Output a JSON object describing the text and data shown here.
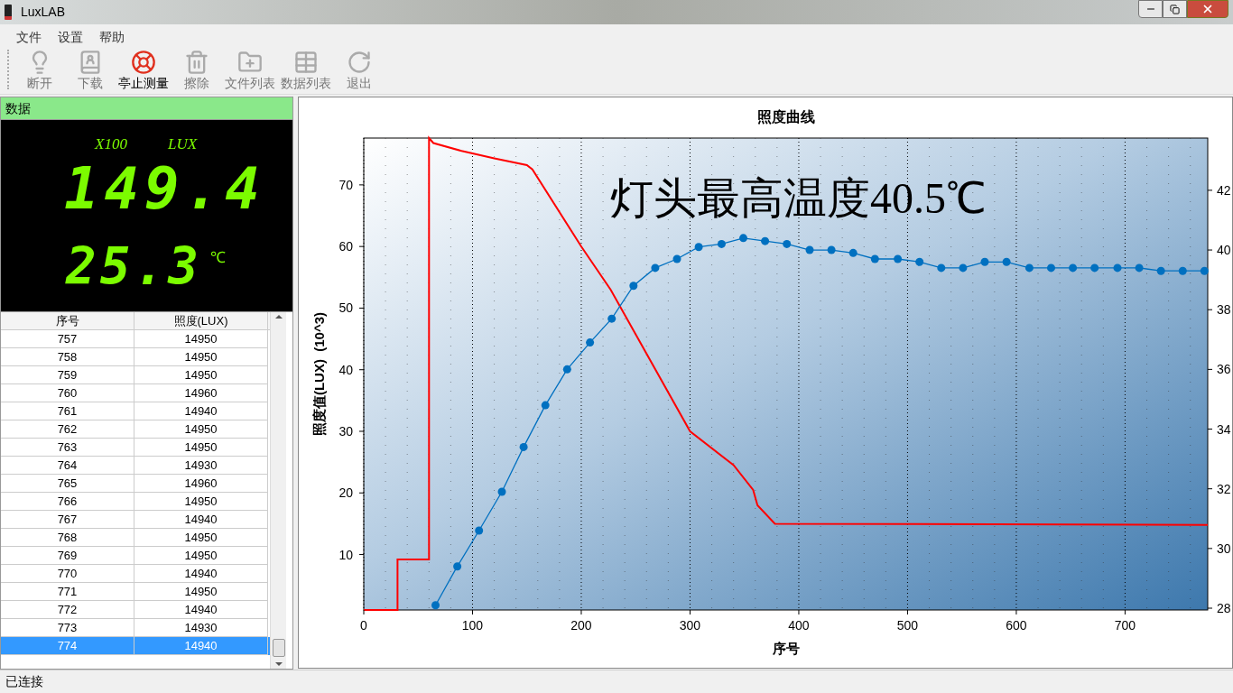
{
  "window": {
    "title": "LuxLAB"
  },
  "menu": [
    "文件",
    "设置",
    "帮助"
  ],
  "toolbar": [
    {
      "label": "断开",
      "disabled": true
    },
    {
      "label": "下载",
      "disabled": true
    },
    {
      "label": "亭止测量",
      "disabled": false
    },
    {
      "label": "擦除",
      "disabled": true
    },
    {
      "label": "文件列表",
      "disabled": true
    },
    {
      "label": "数据列表",
      "disabled": true
    },
    {
      "label": "退出",
      "disabled": true
    }
  ],
  "data_panel": {
    "title": "数据",
    "scale": "X100",
    "unit": "LUX",
    "reading": "149.4",
    "temperature": "25.3",
    "temp_unit": "℃"
  },
  "table": {
    "columns": [
      "序号",
      "照度(LUX)"
    ],
    "rows": [
      {
        "cells": [
          "757",
          "14950"
        ],
        "selected": false
      },
      {
        "cells": [
          "758",
          "14950"
        ],
        "selected": false
      },
      {
        "cells": [
          "759",
          "14950"
        ],
        "selected": false
      },
      {
        "cells": [
          "760",
          "14960"
        ],
        "selected": false
      },
      {
        "cells": [
          "761",
          "14940"
        ],
        "selected": false
      },
      {
        "cells": [
          "762",
          "14950"
        ],
        "selected": false
      },
      {
        "cells": [
          "763",
          "14950"
        ],
        "selected": false
      },
      {
        "cells": [
          "764",
          "14930"
        ],
        "selected": false
      },
      {
        "cells": [
          "765",
          "14960"
        ],
        "selected": false
      },
      {
        "cells": [
          "766",
          "14950"
        ],
        "selected": false
      },
      {
        "cells": [
          "767",
          "14940"
        ],
        "selected": false
      },
      {
        "cells": [
          "768",
          "14950"
        ],
        "selected": false
      },
      {
        "cells": [
          "769",
          "14950"
        ],
        "selected": false
      },
      {
        "cells": [
          "770",
          "14940"
        ],
        "selected": false
      },
      {
        "cells": [
          "771",
          "14950"
        ],
        "selected": false
      },
      {
        "cells": [
          "772",
          "14940"
        ],
        "selected": false
      },
      {
        "cells": [
          "773",
          "14930"
        ],
        "selected": false
      },
      {
        "cells": [
          "774",
          "14940"
        ],
        "selected": true
      }
    ]
  },
  "chart": {
    "chart_data": {
      "type": "line",
      "title": "照度曲线",
      "xlabel": "序号",
      "ylabel": "照度值(LUX)  (10^3)",
      "xlim": [
        0,
        776
      ],
      "ylim": [
        1,
        77.6
      ],
      "y2lim": [
        27.94,
        43.75
      ],
      "xticks": [
        0,
        100,
        200,
        300,
        400,
        500,
        600,
        700
      ],
      "yticks": [
        10,
        20,
        30,
        40,
        50,
        60,
        70
      ],
      "y2ticks": [
        28,
        30,
        32,
        34,
        36,
        38,
        40,
        42
      ],
      "annotations": [
        "灯头最高温度40.5℃"
      ],
      "grid": "x",
      "series": [
        {
          "color": "#ff0000",
          "x": [
            0,
            31,
            31,
            60,
            60,
            64,
            90,
            120,
            150,
            155,
            200,
            227,
            300,
            340,
            358,
            362,
            378,
            776
          ],
          "values": [
            1,
            1,
            9.2,
            9.2,
            77.6,
            76.8,
            75.5,
            74.3,
            73.2,
            72.5,
            60,
            53,
            30,
            24.5,
            20.5,
            18,
            15,
            14.8
          ]
        },
        {
          "color": "#0070c0",
          "axis": "y2",
          "marker": "circle",
          "x": [
            66,
            86,
            106,
            127,
            147,
            167,
            187,
            208,
            228,
            248,
            268,
            288,
            308,
            329,
            349,
            369,
            389,
            410,
            430,
            450,
            470,
            491,
            511,
            531,
            551,
            571,
            591,
            612,
            632,
            652,
            672,
            693,
            713,
            733,
            753,
            773
          ],
          "values": [
            28.1,
            29.4,
            30.6,
            31.9,
            33.4,
            34.8,
            36.0,
            36.9,
            37.7,
            38.8,
            39.4,
            39.7,
            40.1,
            40.2,
            40.4,
            40.3,
            40.2,
            40.0,
            40.0,
            39.9,
            39.7,
            39.7,
            39.6,
            39.4,
            39.4,
            39.6,
            39.6,
            39.4,
            39.4,
            39.4,
            39.4,
            39.4,
            39.4,
            39.3,
            39.3,
            39.3
          ]
        }
      ]
    }
  },
  "status_bar": "已连接"
}
